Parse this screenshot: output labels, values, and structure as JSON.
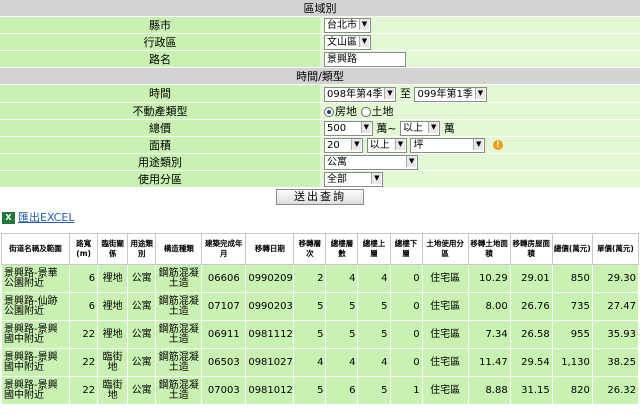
{
  "sections": {
    "region": "區域別",
    "time_type": "時間/類型"
  },
  "form": {
    "city": {
      "label": "縣市",
      "value": "台北市"
    },
    "district": {
      "label": "行政區",
      "value": "文山區"
    },
    "road": {
      "label": "路名",
      "value": "景興路"
    },
    "period": {
      "label": "時間",
      "from": "098年第4季",
      "to_word": "至",
      "to": "099年第1季"
    },
    "property_type": {
      "label": "不動產類型",
      "option1": "房地",
      "option2": "土地",
      "selected": "房地"
    },
    "total_price": {
      "label": "總價",
      "value": "500",
      "unit1": "萬~",
      "cond": "以上",
      "unit2": "萬"
    },
    "area": {
      "label": "面積",
      "value": "20",
      "cond": "以上",
      "unit": "坪"
    },
    "usage": {
      "label": "用途類別",
      "value": "公寓"
    },
    "zoning": {
      "label": "使用分區",
      "value": "全部"
    },
    "query_button": "送出查詢"
  },
  "export_label": "匯出EXCEL",
  "table": {
    "headers": [
      "街道名稱及範圍",
      "路寬(m)",
      "臨街關係",
      "用途類別",
      "構造種類",
      "建築完成年月",
      "移轉日期",
      "移轉層次",
      "總樓層數",
      "總樓上層",
      "總樓下層",
      "土地使用分區",
      "移轉土地面積",
      "移轉房屋面積",
      "總價(萬元)",
      "單價(萬元)"
    ],
    "rows": [
      [
        "景興路-景華公園附近",
        "6",
        "裡地",
        "公寓",
        "鋼筋混凝土造",
        "06606",
        "0990209",
        "2",
        "4",
        "4",
        "0",
        "住宅區",
        "10.29",
        "29.01",
        "850",
        "29.30"
      ],
      [
        "景興路-仙跡公園附近",
        "6",
        "裡地",
        "公寓",
        "鋼筋混凝土造",
        "07107",
        "0990203",
        "5",
        "5",
        "5",
        "0",
        "住宅區",
        "8.00",
        "26.76",
        "735",
        "27.47"
      ],
      [
        "景興路-景興國中附近",
        "22",
        "裡地",
        "公寓",
        "鋼筋混凝土造",
        "06911",
        "0981112",
        "5",
        "5",
        "5",
        "0",
        "住宅區",
        "7.34",
        "26.58",
        "955",
        "35.93"
      ],
      [
        "景興路-景興國中附近",
        "22",
        "臨街地",
        "公寓",
        "鋼筋混凝土造",
        "06503",
        "0981027",
        "4",
        "4",
        "4",
        "0",
        "住宅區",
        "11.47",
        "29.54",
        "1,130",
        "38.25"
      ],
      [
        "景興路-景興國中附近",
        "22",
        "臨街地",
        "公寓",
        "鋼筋混凝土造",
        "07003",
        "0981012",
        "5",
        "6",
        "5",
        "1",
        "住宅區",
        "8.88",
        "31.15",
        "820",
        "26.32"
      ]
    ]
  }
}
